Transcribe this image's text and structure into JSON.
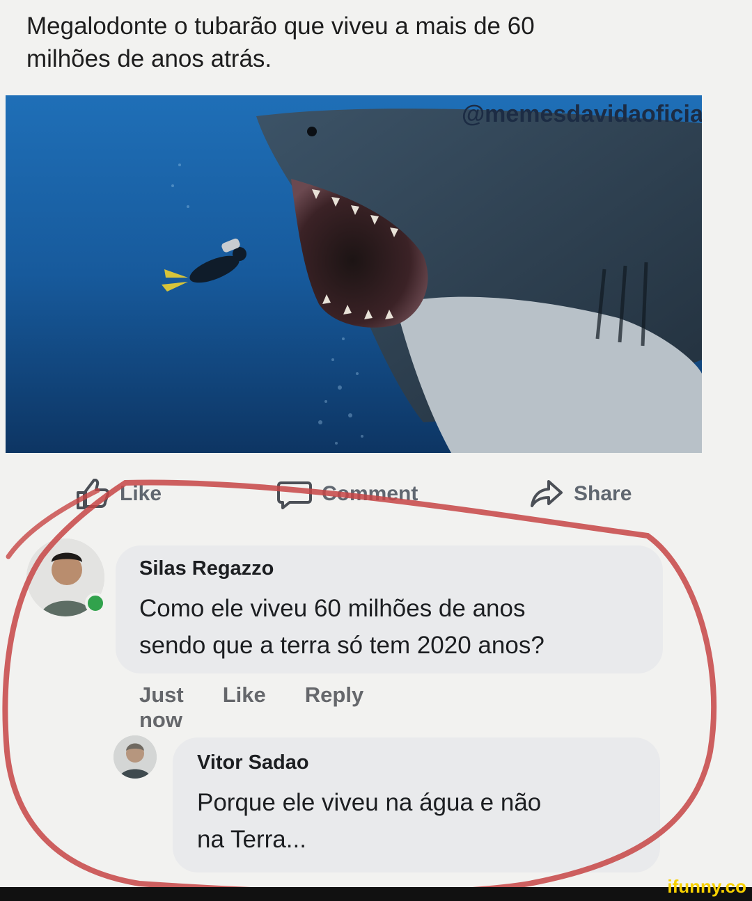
{
  "post": {
    "line1": "Megalodonte o tubarão que viveu a mais de 60",
    "line2": "milhões de anos atrás.",
    "image_watermark": "@memesdavidaoficia"
  },
  "actions": {
    "like": "Like",
    "comment": "Comment",
    "share": "Share"
  },
  "comments": [
    {
      "author": "Silas Regazzo",
      "line1": "Como ele viveu 60 milhões de anos",
      "line2": "sendo que a terra só tem 2020 anos?",
      "time": "Just now",
      "like": "Like",
      "reply": "Reply"
    },
    {
      "author": "Vitor Sadao",
      "line1": "Porque ele viveu na água e não",
      "line2": "na Terra..."
    }
  ],
  "site": {
    "logo": "ifunny.co"
  },
  "colors": {
    "annotation": "#c74545",
    "accent": "#65676b"
  }
}
